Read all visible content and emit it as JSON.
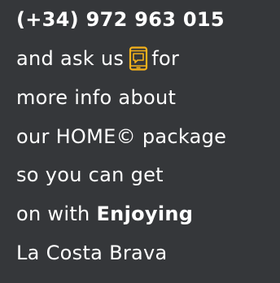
{
  "contact": {
    "phone": "(+34) 972 963 015",
    "line2_prefix": "and ask us",
    "line2_suffix": "for",
    "line3": "more info about",
    "line4": "our HOME© package",
    "line5": "so you can get",
    "line6_prefix": "on with",
    "line6_bold": "Enjoying",
    "line7": "La Costa Brava"
  },
  "icons": {
    "chat": "mobile-chat-icon"
  },
  "colors": {
    "background": "#35373a",
    "text": "#ffffff",
    "accent": "#f5b21b"
  }
}
